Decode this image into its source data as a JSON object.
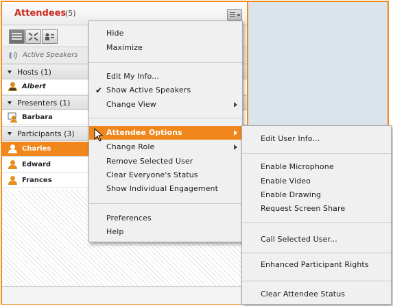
{
  "pod": {
    "title": "Attendees",
    "count": "(5)"
  },
  "speakers": {
    "label": "Active Speakers"
  },
  "sections": {
    "hosts": "Hosts (1)",
    "presenters": "Presenters (1)",
    "participants": "Participants (3)"
  },
  "users": {
    "host": "Albert",
    "presenter": "Barbara",
    "participant1": "Charles",
    "participant2": "Edward",
    "participant3": "Frances"
  },
  "menu": {
    "hide": "Hide",
    "maximize": "Maximize",
    "edit_my_info": "Edit My Info...",
    "show_active_speakers": "Show Active Speakers",
    "show_active_speakers_checked": true,
    "change_view": "Change View",
    "attendee_options": "Attendee Options",
    "change_role": "Change Role",
    "remove_selected_user": "Remove Selected User",
    "clear_status": "Clear Everyone's Status",
    "show_engagement": "Show Individual Engagement",
    "preferences": "Preferences",
    "help": "Help"
  },
  "submenu": {
    "edit_user_info": "Edit User Info...",
    "enable_microphone": "Enable Microphone",
    "enable_video": "Enable Video",
    "enable_drawing": "Enable Drawing",
    "request_screen_share": "Request Screen Share",
    "call_selected_user": "Call Selected User...",
    "enhanced_rights": "Enhanced Participant Rights",
    "clear_attendee_status": "Clear Attendee Status"
  },
  "colors": {
    "accent": "#f0861c",
    "title_red": "#cc2a22",
    "host_icon": "#d98a1a",
    "participant_icon": "#e7901c"
  }
}
